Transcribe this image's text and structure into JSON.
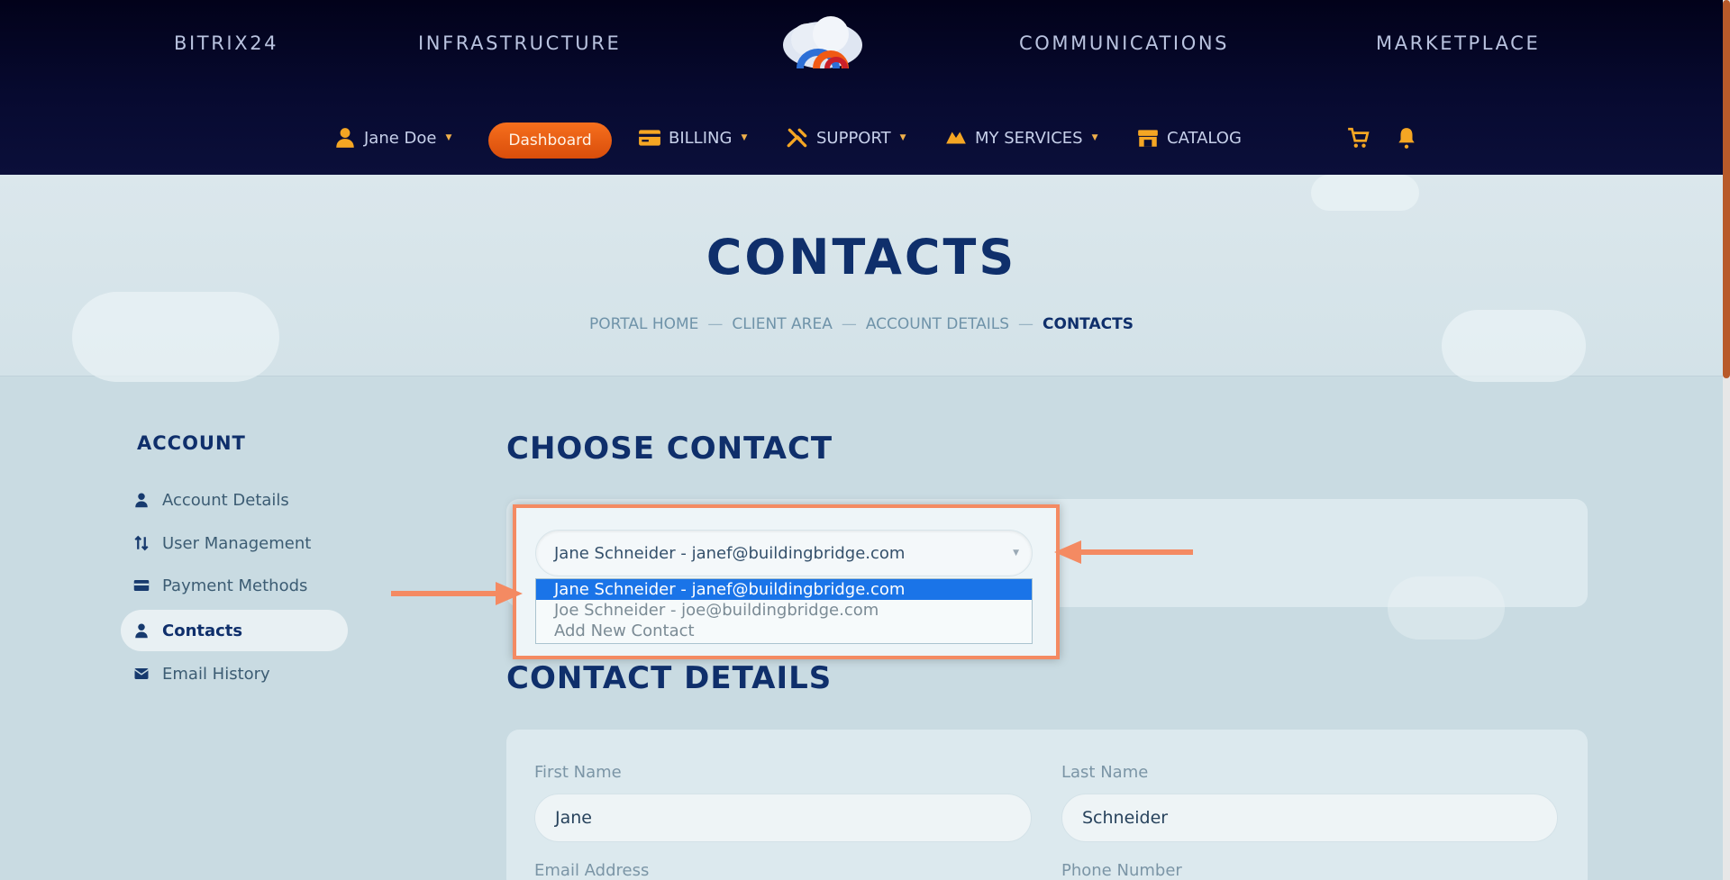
{
  "top_nav": {
    "links": [
      "BITRIX24",
      "INFRASTRUCTURE",
      "COMMUNICATIONS",
      "MARKETPLACE"
    ]
  },
  "sub_nav": {
    "user": "Jane Doe",
    "dashboard": "Dashboard",
    "billing": "BILLING",
    "support": "SUPPORT",
    "my_services": "MY SERVICES",
    "catalog": "CATALOG"
  },
  "banner": {
    "title": "CONTACTS",
    "breadcrumb": [
      "PORTAL HOME",
      "CLIENT AREA",
      "ACCOUNT DETAILS",
      "CONTACTS"
    ],
    "separator": "—"
  },
  "sidebar": {
    "title": "ACCOUNT",
    "items": [
      {
        "label": "Account Details",
        "icon": "user-icon"
      },
      {
        "label": "User Management",
        "icon": "sort-arrows-icon"
      },
      {
        "label": "Payment Methods",
        "icon": "credit-card-icon"
      },
      {
        "label": "Contacts",
        "icon": "user-icon",
        "active": true
      },
      {
        "label": "Email History",
        "icon": "envelope-icon"
      }
    ]
  },
  "choose_contact": {
    "heading": "CHOOSE CONTACT",
    "selected": "Jane Schneider - janef@buildingbridge.com",
    "options": [
      "Jane Schneider - janef@buildingbridge.com",
      "Joe Schneider - joe@buildingbridge.com",
      "Add New Contact"
    ]
  },
  "contact_details": {
    "heading": "CONTACT DETAILS",
    "first_name_label": "First Name",
    "first_name_value": "Jane",
    "last_name_label": "Last Name",
    "last_name_value": "Schneider",
    "email_label": "Email Address",
    "phone_label": "Phone Number"
  },
  "colors": {
    "accent_orange": "#f66f1d",
    "annotation_highlight": "#f48a62",
    "dropdown_selected": "#1a74e8",
    "navy": "#0f2f6b"
  }
}
